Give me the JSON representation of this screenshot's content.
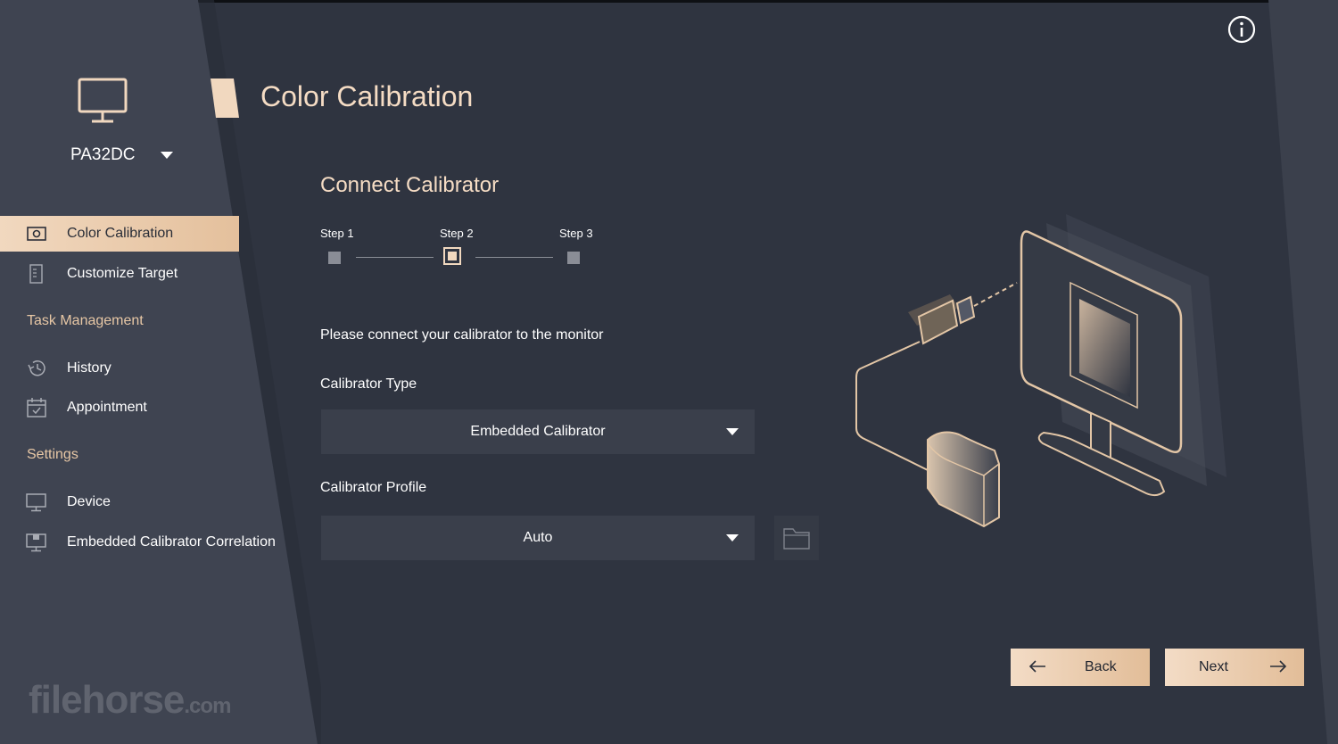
{
  "device": {
    "name": "PA32DC"
  },
  "sidebar": {
    "items": [
      {
        "label": "Color Calibration",
        "icon": "calibration-icon",
        "active": true
      },
      {
        "label": "Customize Target",
        "icon": "document-icon",
        "active": false
      }
    ],
    "task_management": {
      "title": "Task Management",
      "items": [
        {
          "label": "History",
          "icon": "history-icon"
        },
        {
          "label": "Appointment",
          "icon": "calendar-icon"
        }
      ]
    },
    "settings": {
      "title": "Settings",
      "items": [
        {
          "label": "Device",
          "icon": "monitor-icon"
        },
        {
          "label": "Embedded Calibrator Correlation",
          "icon": "monitor-calibrator-icon"
        }
      ]
    }
  },
  "watermark": {
    "main": "filehorse",
    "suffix": ".com"
  },
  "main": {
    "title": "Color Calibration",
    "subtitle": "Connect Calibrator",
    "steps": [
      "Step 1",
      "Step 2",
      "Step 3"
    ],
    "current_step": 2,
    "instruction": "Please connect your calibrator to the monitor",
    "calibrator_type": {
      "label": "Calibrator Type",
      "value": "Embedded Calibrator"
    },
    "calibrator_profile": {
      "label": "Calibrator Profile",
      "value": "Auto"
    }
  },
  "buttons": {
    "back": "Back",
    "next": "Next"
  },
  "colors": {
    "background": "#2f3440",
    "sidebar": "#3e4350",
    "accent": "#f1d8bf",
    "accent_text": "#e7c7a5"
  }
}
